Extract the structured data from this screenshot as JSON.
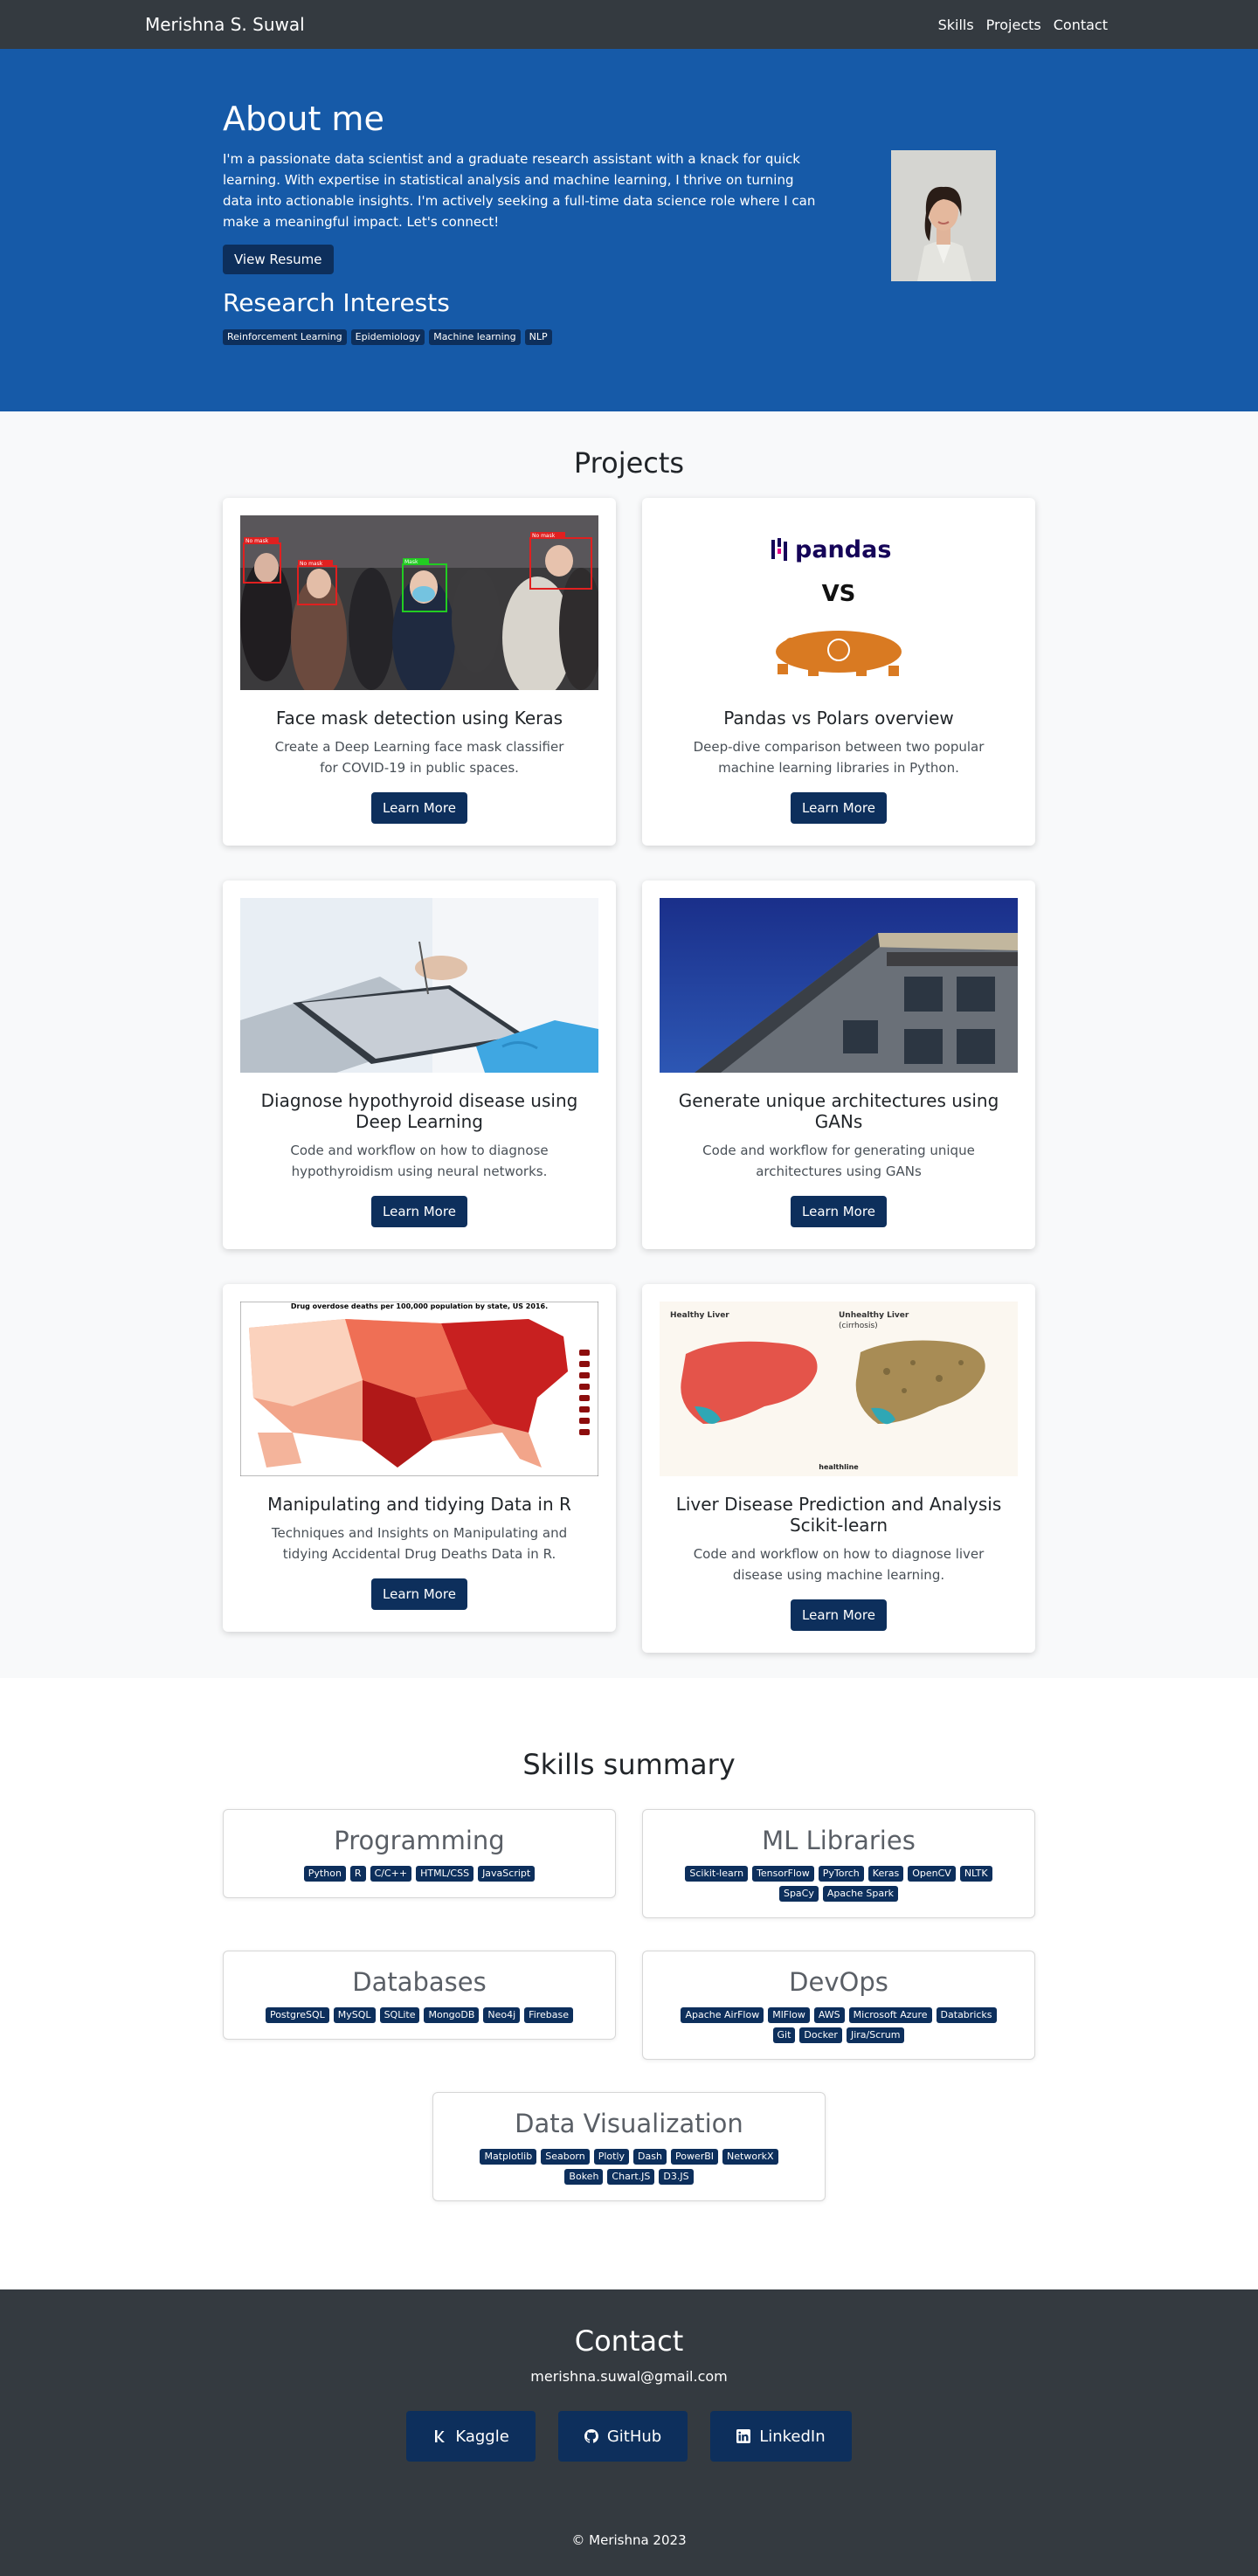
{
  "nav": {
    "brand": "Merishna S. Suwal",
    "links": [
      "Skills",
      "Projects",
      "Contact"
    ]
  },
  "hero": {
    "title": "About me",
    "bio": "I'm a passionate data scientist and a graduate research assistant with a knack for quick learning. With expertise in statistical analysis and machine learning, I thrive on turning data into actionable insights. I'm actively seeking a full-time data science role where I can make a meaningful impact. Let's connect!",
    "resume_button": "View Resume",
    "interests_title": "Research Interests",
    "interests": [
      "Reinforcement Learning",
      "Epidemiology",
      "Machine learning",
      "NLP"
    ]
  },
  "projects": {
    "title": "Projects",
    "cards": [
      {
        "title": "Face mask detection using Keras",
        "text": "Create a Deep Learning face mask classifier for COVID-19 in public spaces.",
        "button": "Learn More",
        "image_labels": [
          "No mask",
          "No mask",
          "Mask",
          "No mask"
        ]
      },
      {
        "title": "Pandas vs Polars overview",
        "text": "Deep-dive comparison between two popular machine learning libraries in Python.",
        "button": "Learn More",
        "image_labels": [
          "pandas",
          "VS"
        ]
      },
      {
        "title": "Diagnose hypothyroid disease using Deep Learning",
        "text": "Code and workflow on how to diagnose hypothyroidism using neural networks.",
        "button": "Learn More"
      },
      {
        "title": "Generate unique architectures using GANs",
        "text": "Code and workflow for generating unique architectures using GANs",
        "button": "Learn More"
      },
      {
        "title": "Manipulating and tidying Data in R",
        "text": "Techniques and Insights on Manipulating and tidying Accidental Drug Deaths Data in R.",
        "button": "Learn More",
        "image_labels": [
          "Drug overdose deaths per 100,000 population by state, US 2016."
        ]
      },
      {
        "title": "Liver Disease Prediction and Analysis Scikit-learn",
        "text": "Code and workflow on how to diagnose liver disease using machine learning.",
        "button": "Learn More",
        "image_labels": [
          "Healthy Liver",
          "Unhealthy Liver",
          "(cirrhosis)",
          "healthline"
        ]
      }
    ]
  },
  "skills": {
    "title": "Skills summary",
    "groups": [
      {
        "title": "Programming",
        "items": [
          "Python",
          "R",
          "C/C++",
          "HTML/CSS",
          "JavaScript"
        ]
      },
      {
        "title": "ML Libraries",
        "items": [
          "Scikit-learn",
          "TensorFlow",
          "PyTorch",
          "Keras",
          "OpenCV",
          "NLTK",
          "SpaCy",
          "Apache Spark"
        ]
      },
      {
        "title": "Databases",
        "items": [
          "PostgreSQL",
          "MySQL",
          "SQLite",
          "MongoDB",
          "Neo4j",
          "Firebase"
        ]
      },
      {
        "title": "DevOps",
        "items": [
          "Apache AirFlow",
          "MlFlow",
          "AWS",
          "Microsoft Azure",
          "Databricks",
          "Git",
          "Docker",
          "Jira/Scrum"
        ]
      },
      {
        "title": "Data Visualization",
        "items": [
          "Matplotlib",
          "Seaborn",
          "Plotly",
          "Dash",
          "PowerBI",
          "NetworkX",
          "Bokeh",
          "Chart.JS",
          "D3.JS"
        ]
      }
    ]
  },
  "contact": {
    "title": "Contact",
    "email": "merishna.suwal@gmail.com",
    "socials": [
      {
        "label": "Kaggle",
        "icon": "kaggle-icon"
      },
      {
        "label": "GitHub",
        "icon": "github-icon"
      },
      {
        "label": "LinkedIn",
        "icon": "linkedin-icon"
      }
    ],
    "copyright": "© Merishna 2023"
  },
  "colors": {
    "navbar": "#343a40",
    "hero": "#165aa8",
    "accent_button": "#0d2f5c",
    "projects_bg": "#f8f9fa"
  }
}
